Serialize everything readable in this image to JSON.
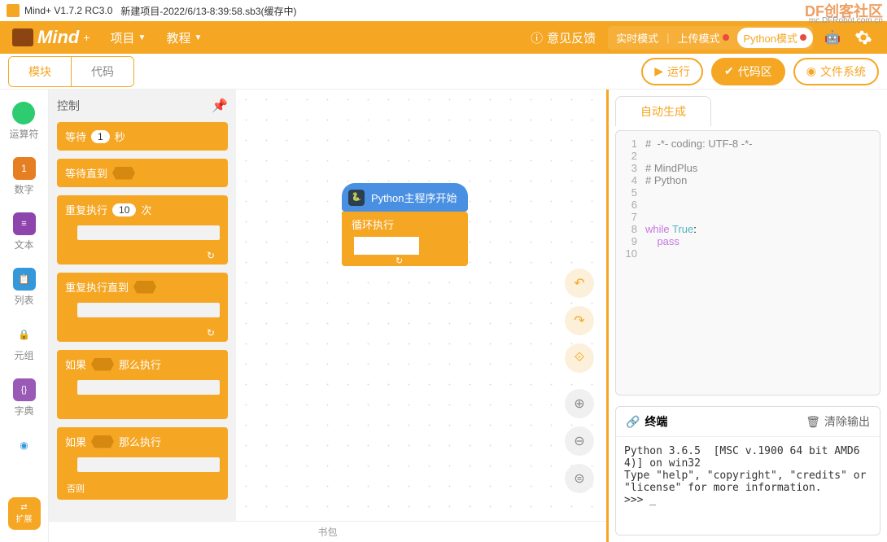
{
  "titlebar": {
    "app_name": "Mind+ V1.7.2 RC3.0",
    "project": "新建项目-2022/6/13-8:39:58.sb3(缓存中)",
    "watermark": "DF创客社区",
    "watermark_sub": "mc.DFRobot.com.cn"
  },
  "topbar": {
    "logo": "Mind",
    "logo_plus": "+",
    "menu_project": "项目",
    "menu_tutorial": "教程",
    "feedback": "意见反馈",
    "mode_realtime": "实时模式",
    "mode_upload": "上传模式",
    "mode_python": "Python模式"
  },
  "subbar": {
    "tab_blocks": "模块",
    "tab_code": "代码",
    "btn_run": "运行",
    "btn_code_area": "代码区",
    "btn_filesystem": "文件系统"
  },
  "categories": {
    "operator": "运算符",
    "number": "数字",
    "text": "文本",
    "list": "列表",
    "tuple": "元组",
    "dict": "字典",
    "extension": "扩展"
  },
  "palette": {
    "header": "控制",
    "wait": "等待",
    "wait_val": "1",
    "wait_sec": "秒",
    "wait_until": "等待直到",
    "repeat": "重复执行",
    "repeat_val": "10",
    "repeat_times": "次",
    "repeat_until": "重复执行直到",
    "if": "如果",
    "then": "那么执行",
    "else": "否则"
  },
  "canvas": {
    "hat": "Python主程序开始",
    "loop": "循环执行"
  },
  "rightpanel": {
    "autogen": "自动生成",
    "code": [
      {
        "n": "1",
        "t": "#  -*- coding: UTF-8 -*-",
        "c": "comment"
      },
      {
        "n": "2",
        "t": "",
        "c": ""
      },
      {
        "n": "3",
        "t": "# MindPlus",
        "c": "comment"
      },
      {
        "n": "4",
        "t": "# Python",
        "c": "comment"
      },
      {
        "n": "5",
        "t": "",
        "c": ""
      },
      {
        "n": "6",
        "t": "",
        "c": ""
      },
      {
        "n": "7",
        "t": "",
        "c": ""
      },
      {
        "n": "8",
        "t": "while True:",
        "c": "code8"
      },
      {
        "n": "9",
        "t": "    pass",
        "c": "code9"
      },
      {
        "n": "10",
        "t": "",
        "c": ""
      }
    ],
    "terminal_title": "终端",
    "clear_output": "清除输出",
    "terminal_text": "Python 3.6.5  [MSC v.1900 64 bit AMD64)] on win32\nType \"help\", \"copyright\", \"credits\" or \"license\" for more information.\n>>> _"
  },
  "bagbar": "书包"
}
